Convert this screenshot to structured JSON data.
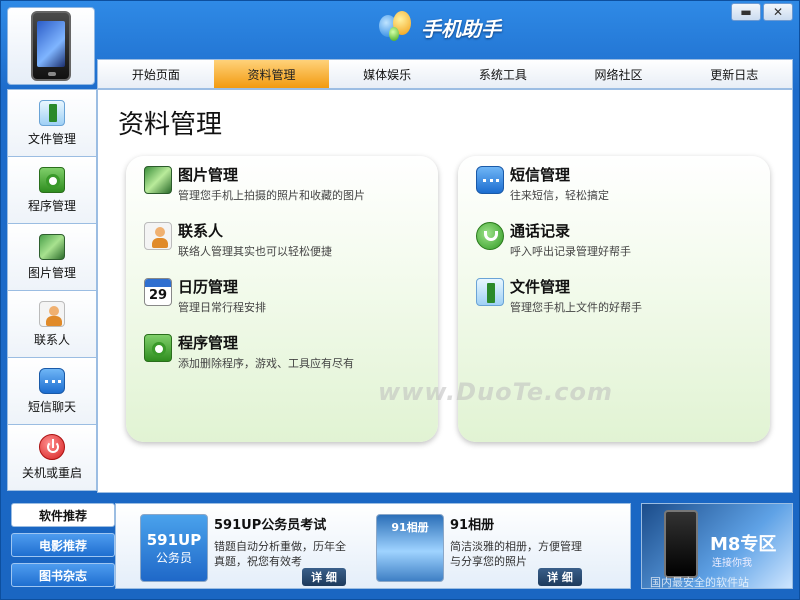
{
  "window": {
    "title": "手机助手",
    "minimize_label": "▬",
    "close_label": "✕"
  },
  "tabs": [
    {
      "label": "开始页面"
    },
    {
      "label": "资料管理"
    },
    {
      "label": "媒体娱乐"
    },
    {
      "label": "系统工具"
    },
    {
      "label": "网络社区"
    },
    {
      "label": "更新日志"
    }
  ],
  "active_tab": "资料管理",
  "sidebar": {
    "items": [
      {
        "label": "文件管理",
        "icon": "file-manager-icon"
      },
      {
        "label": "程序管理",
        "icon": "app-manager-icon"
      },
      {
        "label": "图片管理",
        "icon": "picture-manager-icon"
      },
      {
        "label": "联系人",
        "icon": "contacts-icon"
      },
      {
        "label": "短信聊天",
        "icon": "sms-chat-icon"
      },
      {
        "label": "关机或重启",
        "icon": "power-icon"
      }
    ]
  },
  "main": {
    "title": "资料管理",
    "left_features": [
      {
        "name": "图片管理",
        "desc": "管理您手机上拍摄的照片和收藏的图片",
        "icon": "picture-icon"
      },
      {
        "name": "联系人",
        "desc": "联络人管理其实也可以轻松便捷",
        "icon": "contacts-icon"
      },
      {
        "name": "日历管理",
        "desc": "管理日常行程安排",
        "icon": "calendar-icon",
        "badge": "29"
      },
      {
        "name": "程序管理",
        "desc": "添加删除程序，游戏、工具应有尽有",
        "icon": "app-icon"
      }
    ],
    "right_features": [
      {
        "name": "短信管理",
        "desc": "往来短信，轻松搞定",
        "icon": "sms-icon"
      },
      {
        "name": "通话记录",
        "desc": "呼入呼出记录管理好帮手",
        "icon": "phone-call-icon"
      },
      {
        "name": "文件管理",
        "desc": "管理您手机上文件的好帮手",
        "icon": "file-icon"
      }
    ],
    "watermark": "www.DuoTe.com"
  },
  "bottom": {
    "tabs": [
      {
        "label": "软件推荐",
        "active": true
      },
      {
        "label": "电影推荐",
        "active": false
      },
      {
        "label": "图书杂志",
        "active": false
      }
    ],
    "apps": [
      {
        "name": "591UP公务员考试",
        "desc": "错题自动分析重做，历年全真题，祝您有效考",
        "thumb_text": "591UP",
        "thumb_sub": "公务员",
        "detail": "详 细"
      },
      {
        "name": "91相册",
        "desc": "简洁淡雅的相册，方便管理与分享您的照片",
        "thumb_text": "91相册",
        "detail": "详 细"
      }
    ],
    "ad": {
      "title": "M8专区",
      "subtitle": "连接你我",
      "footer": "国内最安全的软件站"
    }
  },
  "colors": {
    "accent_tab": "#f29a10",
    "frame_blue": "#1d6ccb"
  }
}
